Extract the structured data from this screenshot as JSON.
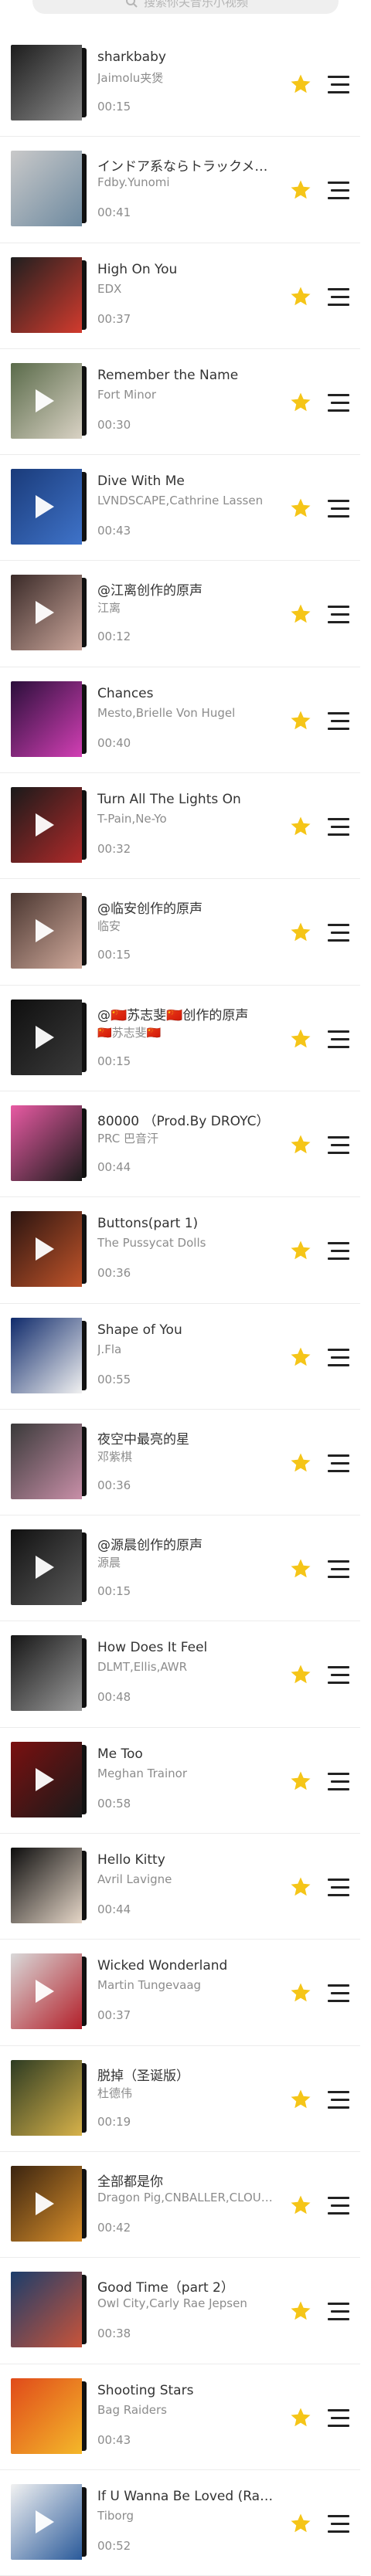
{
  "search": {
    "placeholder": "搜索你关音乐小视频",
    "icon": "search-icon"
  },
  "colors": {
    "star": "#f5c518",
    "menu": "#222222",
    "title": "#333333",
    "meta": "#8c8c8c"
  },
  "songs": [
    {
      "title": "sharkbaby",
      "artist": "Jaimolu夹煲",
      "duration": "00:15",
      "cover": [
        "#1d1d1d",
        "#8a8a8a"
      ],
      "play": false
    },
    {
      "title": "インドア系ならトラックメイ…",
      "artist": "Fdby.Yunomi",
      "duration": "00:41",
      "cover": [
        "#c9c9c9",
        "#6e8aa0"
      ],
      "play": false
    },
    {
      "title": "High On You",
      "artist": "EDX",
      "duration": "00:37",
      "cover": [
        "#1f1f1f",
        "#d23b2e"
      ],
      "play": false
    },
    {
      "title": "Remember the Name",
      "artist": "Fort Minor",
      "duration": "00:30",
      "cover": [
        "#5a6b4a",
        "#d9d2c4"
      ],
      "play": true
    },
    {
      "title": "Dive With Me",
      "artist": "LVNDSCAPE,Cathrine Lassen",
      "duration": "00:43",
      "cover": [
        "#1a3b7a",
        "#3f73c9"
      ],
      "play": true
    },
    {
      "title": "@江离创作的原声",
      "artist": "江离",
      "duration": "00:12",
      "cover": [
        "#3a2a28",
        "#c9a59a"
      ],
      "play": true
    },
    {
      "title": "Chances",
      "artist": "Mesto,Brielle Von Hugel",
      "duration": "00:40",
      "cover": [
        "#2b0f3b",
        "#d23fb4"
      ],
      "play": false
    },
    {
      "title": "Turn All The Lights On",
      "artist": "T-Pain,Ne-Yo",
      "duration": "00:32",
      "cover": [
        "#1a1a1a",
        "#b02a2a"
      ],
      "play": true
    },
    {
      "title": "@临安创作的原声",
      "artist": "临安",
      "duration": "00:15",
      "cover": [
        "#4a3630",
        "#cfa99b"
      ],
      "play": true
    },
    {
      "title": "@🇨🇳苏志斐🇨🇳创作的原声",
      "artist": "🇨🇳苏志斐🇨🇳",
      "duration": "00:15",
      "cover": [
        "#0f0f0f",
        "#3a3a3a"
      ],
      "play": true
    },
    {
      "title": "80000 （Prod.By DROYC）",
      "artist": "PRC 巴音汗",
      "duration": "00:44",
      "cover": [
        "#e85aa3",
        "#1b1b1b"
      ],
      "play": false
    },
    {
      "title": "Buttons(part 1)",
      "artist": "The Pussycat Dolls",
      "duration": "00:36",
      "cover": [
        "#2a1410",
        "#c0542a"
      ],
      "play": true
    },
    {
      "title": "Shape of You",
      "artist": "J.Fla",
      "duration": "00:55",
      "cover": [
        "#0f2a6b",
        "#f1f1f1"
      ],
      "play": false
    },
    {
      "title": "夜空中最亮的星",
      "artist": "邓紫棋",
      "duration": "00:36",
      "cover": [
        "#3a3a3a",
        "#c88fa8"
      ],
      "play": false
    },
    {
      "title": "@源晨创作的原声",
      "artist": "源晨",
      "duration": "00:15",
      "cover": [
        "#111111",
        "#5a5a5a"
      ],
      "play": true
    },
    {
      "title": "How Does It Feel",
      "artist": "DLMT,Ellis,AWR",
      "duration": "00:48",
      "cover": [
        "#161616",
        "#9a9a9a"
      ],
      "play": false
    },
    {
      "title": "Me Too",
      "artist": "Meghan Trainor",
      "duration": "00:58",
      "cover": [
        "#7a1010",
        "#1a1a1a"
      ],
      "play": true
    },
    {
      "title": "Hello Kitty",
      "artist": "Avril Lavigne",
      "duration": "00:44",
      "cover": [
        "#0d0d0d",
        "#e6d7c8"
      ],
      "play": false
    },
    {
      "title": "Wicked Wonderland",
      "artist": "Martin Tungevaag",
      "duration": "00:37",
      "cover": [
        "#d9d9d9",
        "#b3202a"
      ],
      "play": true
    },
    {
      "title": "脱掉（圣诞版）",
      "artist": "杜德伟",
      "duration": "00:19",
      "cover": [
        "#2d3b22",
        "#d7b24a"
      ],
      "play": false
    },
    {
      "title": "全部都是你",
      "artist": "Dragon Pig,CNBALLER,CLOU…",
      "duration": "00:42",
      "cover": [
        "#3b2410",
        "#d98f2a"
      ],
      "play": true
    },
    {
      "title": "Good Time（part 2）",
      "artist": "Owl City,Carly Rae Jepsen",
      "duration": "00:38",
      "cover": [
        "#1b3d6b",
        "#c9543a"
      ],
      "play": false
    },
    {
      "title": "Shooting Stars",
      "artist": "Bag Raiders",
      "duration": "00:43",
      "cover": [
        "#e04a1a",
        "#f4b82a"
      ],
      "play": false
    },
    {
      "title": "If U Wanna Be Loved (Rad…",
      "artist": "Tiborg",
      "duration": "00:52",
      "cover": [
        "#f2f2f2",
        "#2a5a9a"
      ],
      "play": true
    }
  ]
}
